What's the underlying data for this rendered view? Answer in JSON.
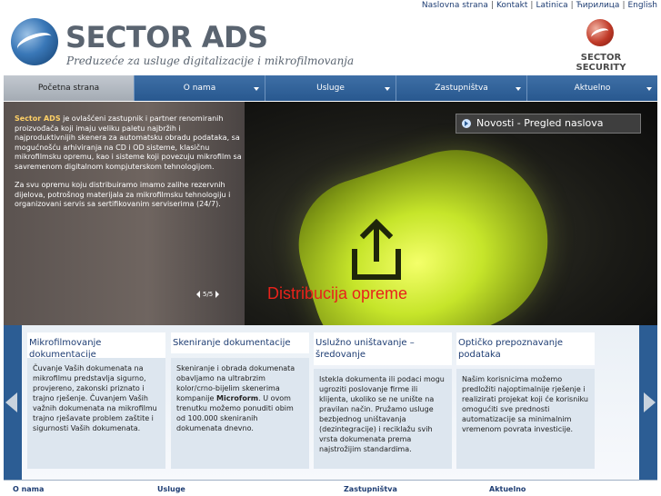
{
  "top_links": [
    "Naslovna strana",
    "Kontakt",
    "Latinica",
    "Ћирилица",
    "English"
  ],
  "header": {
    "brand": "SECTOR ADS",
    "tagline": "Preduzeće za usluge digitalizacije i mikrofilmovanja",
    "security_brand": "SECTOR SECURITY"
  },
  "nav": [
    "Početna strana",
    "O nama",
    "Usluge",
    "Zastupništva",
    "Aktuelno"
  ],
  "hero": {
    "intro_bold": "Sector ADS",
    "intro_rest": " je ovlašćeni zastupnik i partner renomiranih proizvođača koji imaju veliku paletu najbržih i najproduktivnijih skenera za automatsku obradu podataka, sa mogućnošću arhiviranja na CD i OD sisteme, klasičnu mikrofilmsku opremu, kao i sisteme koji povezuju mikrofilm sa savremenom digitalnom kompjuterskom tehnologijom.",
    "paragraph2": "Za svu opremu koju distribuiramo imamo zalihe rezervnih dijelova, potrošnog materijala za mikrofilmsku tehnologiju i organizovani servis sa sertifikovanim serviserima (24/7).",
    "pager": "5/5",
    "slide_title": "Distribucija opreme",
    "news_label": "Novosti - Pregled naslova"
  },
  "cards": [
    {
      "title": "Mikrofilmovanje dokumentacije",
      "text": "Čuvanje Vaših dokumenata na mikrofilmu predstavlja sigurno, provjereno, zakonski priznato i trajno rješenje. Čuvanjem Vaših važnih dokumenata na mikrofilmu trajno rješavate problem zaštite i sigurnosti Vaših dokumenata."
    },
    {
      "title": "Skeniranje dokumentacije",
      "text_before": "Skeniranje i obrada dokumenata obavljamo na ultrabrzim kolor/crno-bijelim skenerima kompanije ",
      "text_bold": "Microform",
      "text_after": ". U ovom trenutku možemo ponuditi obim od 100.000 skeniranih dokumenata dnevno."
    },
    {
      "title": "Uslužno uništavanje – šredovanje",
      "text": "Istekla dokumenta ili podaci mogu ugroziti poslovanje firme ili klijenta, ukoliko se ne unište na pravilan način. Pružamo usluge bezbjednog uništavanja (dezintegracije) i reciklažu svih vrsta dokumenata prema najstrožijim standardima."
    },
    {
      "title": "Optičko prepoznavanje podataka",
      "text": "Našim korisnicima možemo predložiti najoptimalnije rješenje i realizirati projekat koji će korisniku omogućiti sve prednosti automatizacije sa minimalnim vremenom povrata investicije."
    }
  ],
  "footer": [
    "O nama",
    "Usluge",
    "Zastupništva",
    "Aktuelno"
  ],
  "colors": {
    "nav_blue": "#2c5d94",
    "link_blue": "#1e3d73",
    "slide_title_red": "#e8221b",
    "highlight_gold": "#ffd166"
  }
}
